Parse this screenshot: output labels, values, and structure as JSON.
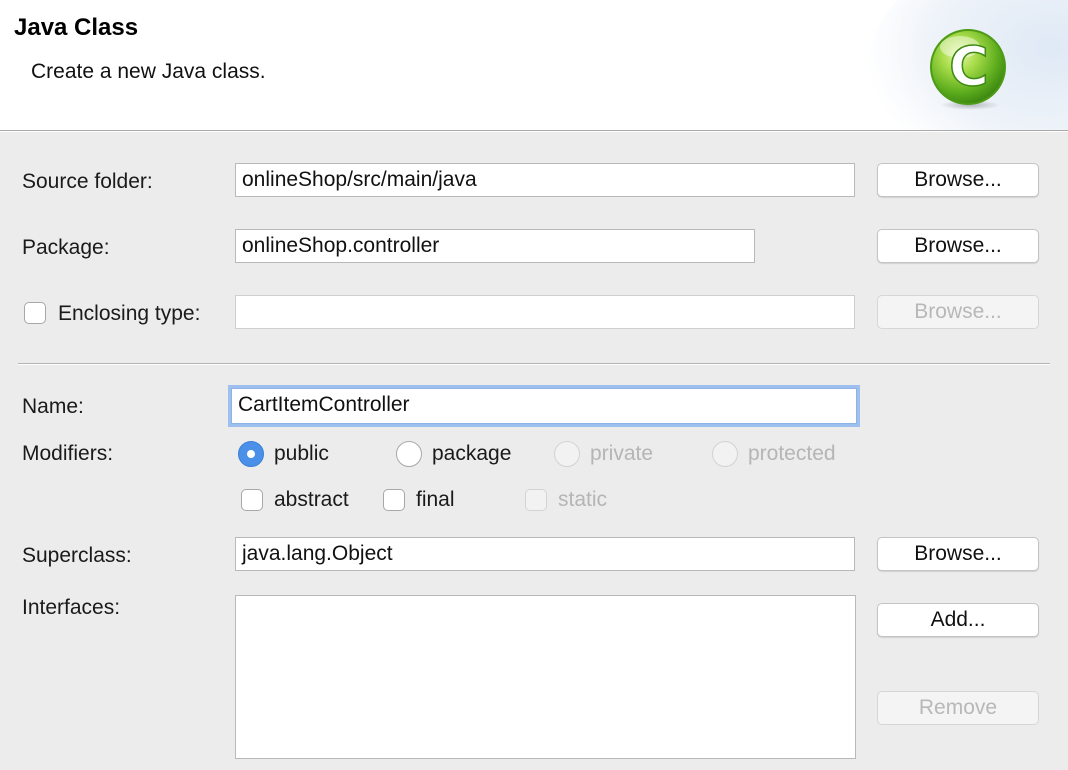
{
  "header": {
    "title": "Java Class",
    "description": "Create a new Java class.",
    "icon": "java-class-c-icon",
    "icon_letter": "C"
  },
  "source_folder": {
    "label": "Source folder:",
    "value": "onlineShop/src/main/java",
    "browse_label": "Browse..."
  },
  "package": {
    "label": "Package:",
    "value": "onlineShop.controller",
    "browse_label": "Browse..."
  },
  "enclosing_type": {
    "label": "Enclosing type:",
    "checked": false,
    "value": "",
    "browse_label": "Browse..."
  },
  "name": {
    "label": "Name:",
    "value": "CartItemController"
  },
  "modifiers": {
    "label": "Modifiers:",
    "visibility_options": [
      {
        "label": "public",
        "selected": true,
        "enabled": true
      },
      {
        "label": "package",
        "selected": false,
        "enabled": true
      },
      {
        "label": "private",
        "selected": false,
        "enabled": false
      },
      {
        "label": "protected",
        "selected": false,
        "enabled": false
      }
    ],
    "flag_options": [
      {
        "label": "abstract",
        "checked": false,
        "enabled": true
      },
      {
        "label": "final",
        "checked": false,
        "enabled": true
      },
      {
        "label": "static",
        "checked": false,
        "enabled": false
      }
    ]
  },
  "superclass": {
    "label": "Superclass:",
    "value": "java.lang.Object",
    "browse_label": "Browse..."
  },
  "interfaces": {
    "label": "Interfaces:",
    "add_label": "Add...",
    "remove_label": "Remove",
    "items": []
  },
  "colors": {
    "accent": "#4a90e8",
    "focus_ring": "#9ec0ef",
    "icon_green": "#7cc734"
  }
}
